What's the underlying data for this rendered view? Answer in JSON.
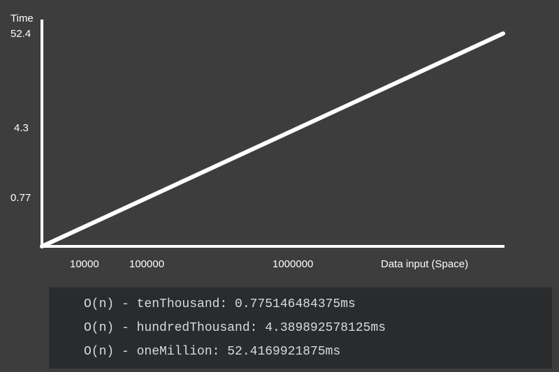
{
  "chart_data": {
    "type": "line",
    "title": "",
    "xlabel": "Data input (Space)",
    "ylabel": "Time",
    "x_scale": "log",
    "y_scale": "log",
    "x_ticks": [
      "10000",
      "100000",
      "1000000"
    ],
    "y_ticks": [
      "0.77",
      "4.3",
      "52.4"
    ],
    "ylim": [
      0.77,
      52.4
    ],
    "x": [
      10000,
      100000,
      1000000
    ],
    "series": [
      {
        "name": "O(n)",
        "values": [
          0.775146484375,
          4.389892578125,
          52.4169921875
        ]
      }
    ]
  },
  "console": {
    "lines": [
      "O(n) - tenThousand: 0.775146484375ms",
      "O(n) - hundredThousand: 4.389892578125ms",
      "O(n) - oneMillion: 52.4169921875ms"
    ]
  }
}
